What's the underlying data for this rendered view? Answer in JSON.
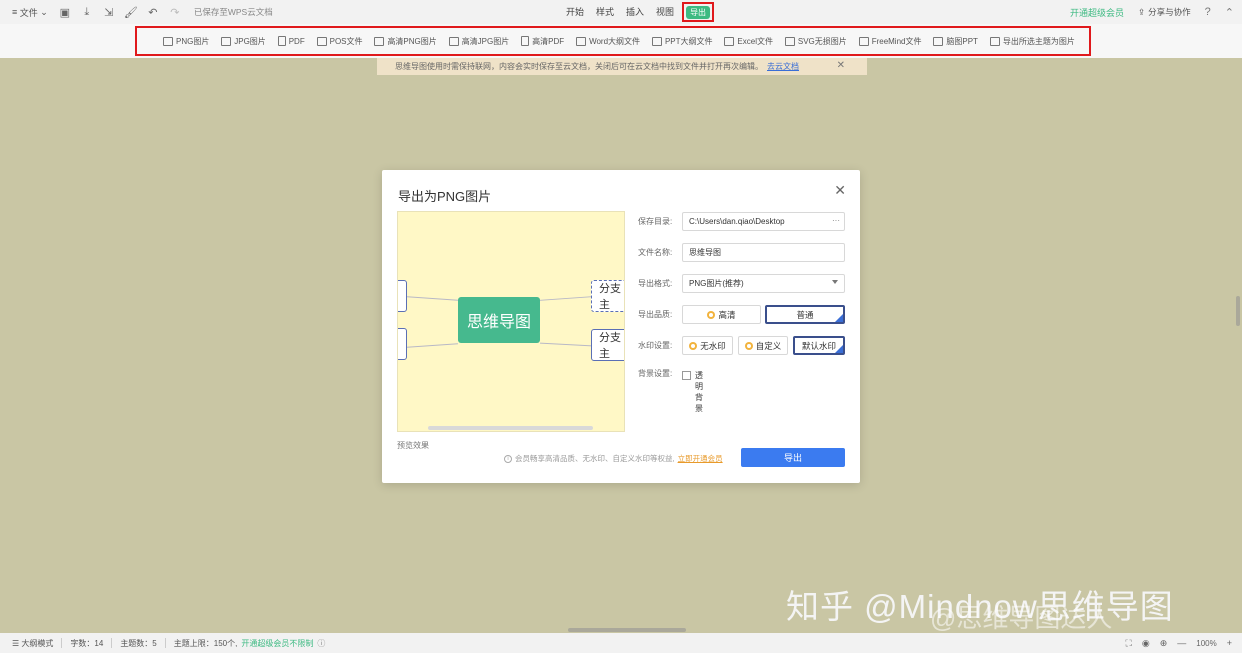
{
  "topbar": {
    "file_menu": "文件",
    "saved_status": "已保存至WPS云文档",
    "tabs": [
      "开始",
      "样式",
      "插入",
      "视图"
    ],
    "active_tab": "导出",
    "vip": "开通超级会员",
    "share": "分享与协作",
    "help": "?"
  },
  "export_bar": {
    "items": [
      "PNG图片",
      "JPG图片",
      "PDF",
      "POS文件",
      "高清PNG图片",
      "高清JPG图片",
      "高清PDF",
      "Word大纲文件",
      "PPT大纲文件",
      "Excel文件",
      "SVG无损图片",
      "FreeMind文件",
      "脑图PPT",
      "导出所选主题为图片"
    ]
  },
  "notice": {
    "text": "思维导图使用时需保持联网，内容会实时保存至云文档，关闭后可在云文档中找到文件并打开再次编辑。",
    "link": "去云文档"
  },
  "dialog": {
    "title": "导出为PNG图片",
    "preview": {
      "center": "思维导图",
      "branch_top": "分支主",
      "branch_bottom": "分支主",
      "label": "预览效果"
    },
    "fields": {
      "save_dir_label": "保存目录:",
      "save_dir_value": "C:\\Users\\dan.qiao\\Desktop",
      "filename_label": "文件名称:",
      "filename_value": "思维导图",
      "format_label": "导出格式:",
      "format_value": "PNG图片(推荐)",
      "quality_label": "导出品质:",
      "quality_hd": "高清",
      "quality_normal": "普通",
      "watermark_label": "水印设置:",
      "watermark_none": "无水印",
      "watermark_custom": "自定义",
      "watermark_default": "默认水印",
      "bg_label": "背景设置:",
      "bg_transparent": "透明背景"
    },
    "tip": "会员畅享高清品质、无水印、自定义水印等权益,",
    "tip_link": "立即开通会员",
    "export_button": "导出"
  },
  "watermark": {
    "line1": "知乎 @Mindnow思维导图",
    "line2": "@思维导图达人"
  },
  "status": {
    "outline_mode": "大纲模式",
    "word_count": "字数：14",
    "topic_count": "主题数：5",
    "topic_limit": "主题上限：150个,",
    "upgrade": "开通超级会员不限制",
    "zoom": "100%"
  }
}
